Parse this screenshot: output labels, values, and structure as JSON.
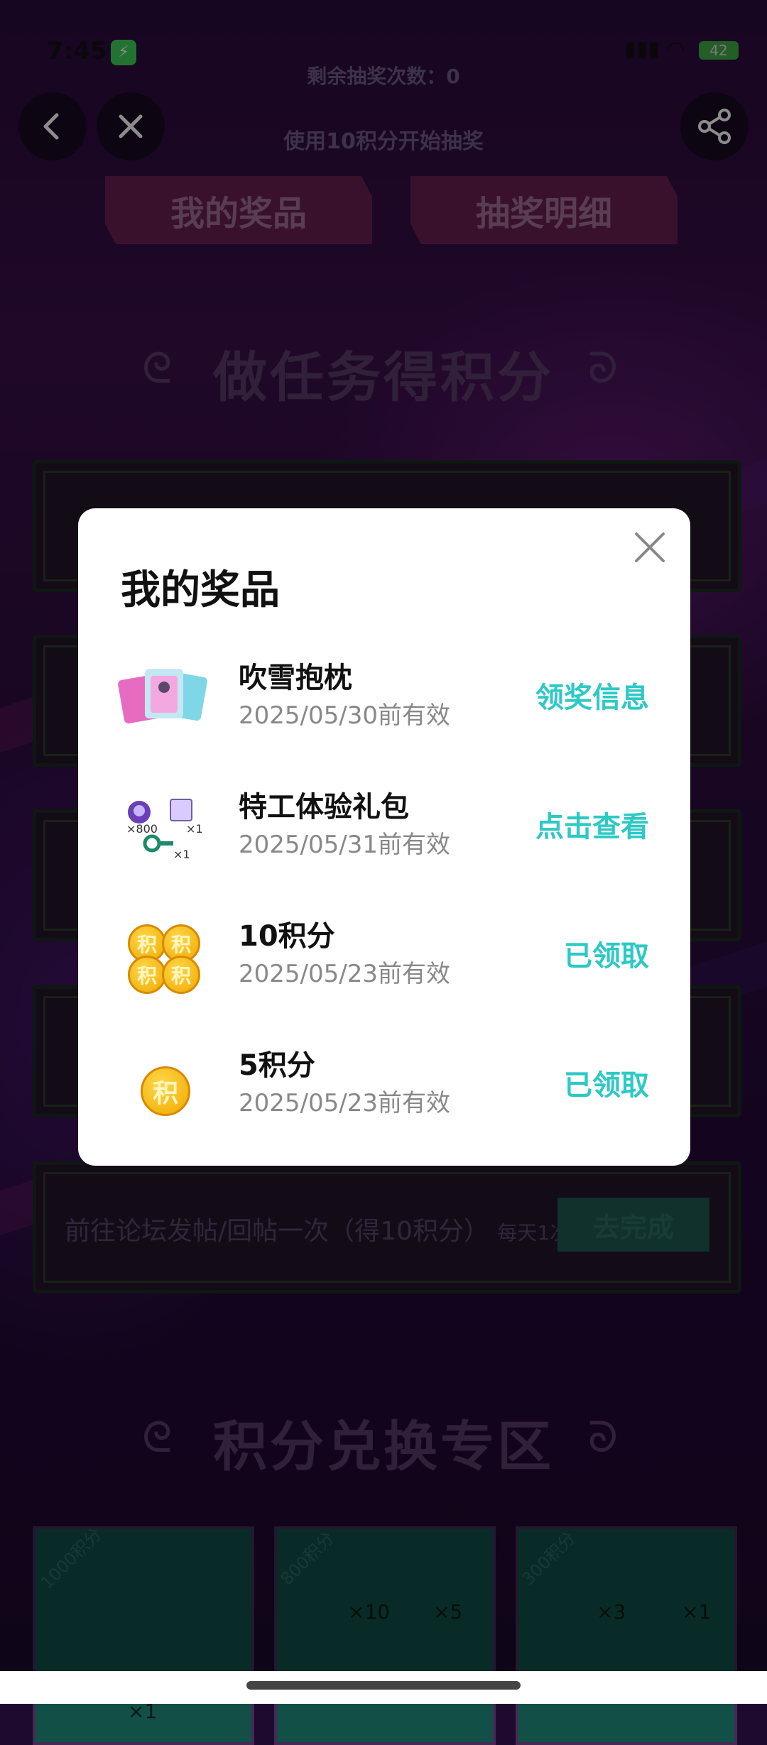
{
  "status": {
    "time": "7:45",
    "battery": "42"
  },
  "background": {
    "remaining_draws": "剩余抽奖次数：0",
    "draw_hint": "使用10积分开始抽奖",
    "tab_my_prizes": "我的奖品",
    "tab_draw_details": "抽奖明细",
    "section_tasks": "做任务得积分",
    "task_last": "前往论坛发帖/回帖一次（得10积分）",
    "task_last_freq": "每天1次",
    "task_last_btn": "去完成",
    "section_exchange": "积分兑换专区",
    "exchange_cards": [
      {
        "price": "1000积分",
        "item": "×1"
      },
      {
        "price": "800积分",
        "item1": "×10",
        "item2": "×5"
      },
      {
        "price": "300积分",
        "item1": "×3",
        "item2": "×1"
      }
    ]
  },
  "modal": {
    "title": "我的奖品",
    "prizes": [
      {
        "name": "吹雪抱枕",
        "date": "2025/05/30前有效",
        "action": "领奖信息",
        "icon": "pillow-icon"
      },
      {
        "name": "特工体验礼包",
        "date": "2025/05/31前有效",
        "action": "点击查看",
        "icon": "gift-pack-icon",
        "qty1": "×800",
        "qty2": "×1",
        "qty3": "×1"
      },
      {
        "name": "10积分",
        "date": "2025/05/23前有效",
        "action": "已领取",
        "icon": "coins-icon",
        "coin_char": "积"
      },
      {
        "name": "5积分",
        "date": "2025/05/23前有效",
        "action": "已领取",
        "icon": "coin-icon",
        "coin_char": "积"
      }
    ]
  },
  "colors": {
    "accent": "#2cc9c5",
    "modal_bg": "#ffffff"
  }
}
